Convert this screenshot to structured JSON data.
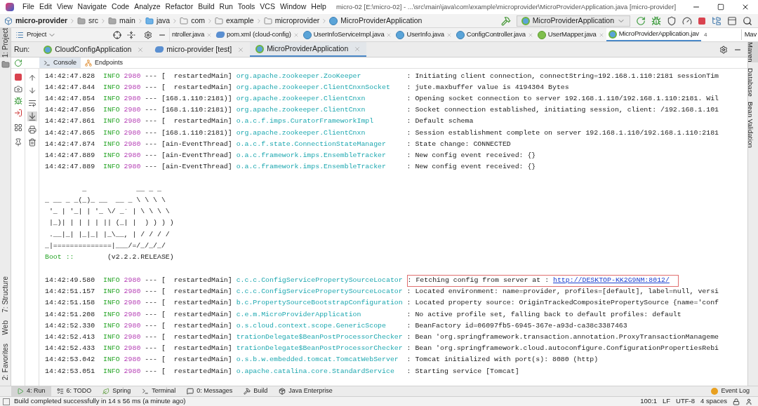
{
  "title_bar": {
    "menu": [
      "File",
      "Edit",
      "View",
      "Navigate",
      "Code",
      "Analyze",
      "Refactor",
      "Build",
      "Run",
      "Tools",
      "VCS",
      "Window",
      "Help"
    ],
    "title": "micro-02 [E:\\micro-02] - ...\\src\\main\\java\\com\\example\\microprovider\\MicroProviderApplication.java [micro-provider]"
  },
  "breadcrumb": [
    {
      "label": "micro-provider",
      "kind": "module"
    },
    {
      "label": "src",
      "kind": "folder"
    },
    {
      "label": "main",
      "kind": "folder"
    },
    {
      "label": "java",
      "kind": "source"
    },
    {
      "label": "com",
      "kind": "package"
    },
    {
      "label": "example",
      "kind": "package"
    },
    {
      "label": "microprovider",
      "kind": "package"
    },
    {
      "label": "MicroProviderApplication",
      "kind": "class"
    }
  ],
  "run_configuration": {
    "label": "MicroProviderApplication"
  },
  "project_panel": {
    "label": "Project"
  },
  "editor_tabs": [
    {
      "label": "ntroller.java",
      "kind": "none",
      "selected": false
    },
    {
      "label": "pom.xml (cloud-config)",
      "kind": "maven",
      "selected": false
    },
    {
      "label": "UserInfoServiceImpl.java",
      "kind": "class",
      "selected": false
    },
    {
      "label": "UserInfo.java",
      "kind": "class",
      "selected": false
    },
    {
      "label": "ConfigController.java",
      "kind": "class",
      "selected": false
    },
    {
      "label": "UserMapper.java",
      "kind": "interface",
      "selected": false
    },
    {
      "label": "MicroProviderApplication.jav",
      "kind": "spring",
      "selected": true
    }
  ],
  "tab_overflow": {
    "count": "4"
  },
  "cut_tab": "Mav",
  "run_panel": {
    "label": "Run:",
    "tabs": [
      {
        "label": "CloudConfigApplication",
        "kind": "spring",
        "selected": false
      },
      {
        "label": "micro-provider [test]",
        "kind": "maven",
        "selected": false
      },
      {
        "label": "MicroProviderApplication",
        "kind": "spring",
        "selected": true
      }
    ],
    "console_tabs": [
      {
        "label": "Console",
        "selected": true
      },
      {
        "label": "Endpoints",
        "selected": false
      }
    ]
  },
  "log": {
    "entries": [
      {
        "time": "14:42:47.828",
        "level": "INFO",
        "pid": "2980",
        "separator": "---",
        "thread": "[  restartedMain]",
        "logger": "org.apache.zookeeper.ZooKeeper",
        "message": ": Initiating client connection, connectString=192.168.1.110:2181 sessionTim"
      },
      {
        "time": "14:42:47.844",
        "level": "INFO",
        "pid": "2980",
        "separator": "---",
        "thread": "[  restartedMain]",
        "logger": "org.apache.zookeeper.ClientCnxnSocket",
        "message": ": jute.maxbuffer value is 4194304 Bytes"
      },
      {
        "time": "14:42:47.854",
        "level": "INFO",
        "pid": "2980",
        "separator": "---",
        "thread": "[168.1.110:2181)]",
        "logger": "org.apache.zookeeper.ClientCnxn",
        "message": ": Opening socket connection to server 192.168.1.110/192.168.1.110:2181. Wil"
      },
      {
        "time": "14:42:47.856",
        "level": "INFO",
        "pid": "2980",
        "separator": "---",
        "thread": "[168.1.110:2181)]",
        "logger": "org.apache.zookeeper.ClientCnxn",
        "message": ": Socket connection established, initiating session, client: /192.168.1.101"
      },
      {
        "time": "14:42:47.861",
        "level": "INFO",
        "pid": "2980",
        "separator": "---",
        "thread": "[  restartedMain]",
        "logger": "o.a.c.f.imps.CuratorFrameworkImpl",
        "message": ": Default schema"
      },
      {
        "time": "14:42:47.865",
        "level": "INFO",
        "pid": "2980",
        "separator": "---",
        "thread": "[168.1.110:2181)]",
        "logger": "org.apache.zookeeper.ClientCnxn",
        "message": ": Session establishment complete on server 192.168.1.110/192.168.1.110:2181"
      },
      {
        "time": "14:42:47.874",
        "level": "INFO",
        "pid": "2980",
        "separator": "---",
        "thread": "[ain-EventThread]",
        "logger": "o.a.c.f.state.ConnectionStateManager",
        "message": ": State change: CONNECTED"
      },
      {
        "time": "14:42:47.889",
        "level": "INFO",
        "pid": "2980",
        "separator": "---",
        "thread": "[ain-EventThread]",
        "logger": "o.a.c.framework.imps.EnsembleTracker",
        "message": ": New config event received: {}"
      },
      {
        "time": "14:42:47.889",
        "level": "INFO",
        "pid": "2980",
        "separator": "---",
        "thread": "[ain-EventThread]",
        "logger": "o.a.c.framework.imps.EnsembleTracker",
        "message": ": New config event received: {}"
      }
    ],
    "banner": {
      "lines": [
        "         _            __ _ _",
        "_ __ _ _(_)_ __  __ _ \\ \\ \\ \\",
        " '_ | '_| | '_ \\/ _` | \\ \\ \\ \\",
        " |_)| | | | | || (_| |  ) ) ) )",
        " .__|_| |_|_| |_\\__, | / / / /",
        "_|==============|___/=/_/_/_/"
      ],
      "boot_label": "Boot ::",
      "version": "(v2.2.2.RELEASE)"
    },
    "later_entries": [
      {
        "time": "14:42:49.580",
        "level": "INFO",
        "pid": "2980",
        "separator": "---",
        "thread": "[  restartedMain]",
        "logger": "c.c.c.ConfigServicePropertySourceLocator",
        "message": ": Fetching config from server at : ",
        "link": "http://DESKTOP-KK2G9NM:8012/",
        "highlighted": true
      },
      {
        "time": "14:42:51.157",
        "level": "INFO",
        "pid": "2980",
        "separator": "---",
        "thread": "[  restartedMain]",
        "logger": "c.c.c.ConfigServicePropertySourceLocator",
        "message": ": Located environment: name=provider, profiles=[default], label=null, versi",
        "highlighted": false
      },
      {
        "time": "14:42:51.158",
        "level": "INFO",
        "pid": "2980",
        "separator": "---",
        "thread": "[  restartedMain]",
        "logger": "b.c.PropertySourceBootstrapConfiguration",
        "message": ": Located property source: OriginTrackedCompositePropertySource {name='conf",
        "highlighted": false
      },
      {
        "time": "14:42:51.208",
        "level": "INFO",
        "pid": "2980",
        "separator": "---",
        "thread": "[  restartedMain]",
        "logger": "c.e.m.MicroProviderApplication",
        "message": ": No active profile set, falling back to default profiles: default",
        "highlighted": false
      },
      {
        "time": "14:42:52.330",
        "level": "INFO",
        "pid": "2980",
        "separator": "---",
        "thread": "[  restartedMain]",
        "logger": "o.s.cloud.context.scope.GenericScope",
        "message": ": BeanFactory id=06097fb5-6945-367e-a93d-ca38c3387463",
        "highlighted": false
      },
      {
        "time": "14:42:52.413",
        "level": "INFO",
        "pid": "2980",
        "separator": "---",
        "thread": "[  restartedMain]",
        "logger": "trationDelegate$BeanPostProcessorChecker",
        "message": ": Bean 'org.springframework.transaction.annotation.ProxyTransactionManageme",
        "highlighted": false
      },
      {
        "time": "14:42:52.433",
        "level": "INFO",
        "pid": "2980",
        "separator": "---",
        "thread": "[  restartedMain]",
        "logger": "trationDelegate$BeanPostProcessorChecker",
        "message": ": Bean 'org.springframework.cloud.autoconfigure.ConfigurationPropertiesRebi",
        "highlighted": false
      },
      {
        "time": "14:42:53.042",
        "level": "INFO",
        "pid": "2980",
        "separator": "---",
        "thread": "[  restartedMain]",
        "logger": "o.s.b.w.embedded.tomcat.TomcatWebServer",
        "message": ": Tomcat initialized with port(s): 8080 (http)",
        "highlighted": false
      },
      {
        "time": "14:42:53.051",
        "level": "INFO",
        "pid": "2980",
        "separator": "---",
        "thread": "[  restartedMain]",
        "logger": "o.apache.catalina.core.StandardService",
        "message": ": Starting service [Tomcat]",
        "highlighted": false
      }
    ]
  },
  "left_tool_tabs": {
    "top": [
      "1: Project"
    ],
    "bottom": [
      "7: Structure",
      "Web",
      "2: Favorites"
    ]
  },
  "right_tool_tabs": [
    {
      "label": "Maven",
      "selected": true
    },
    {
      "label": "Database",
      "selected": false
    },
    {
      "label": "Bean Validation",
      "selected": false
    }
  ],
  "bottom_tool_tabs": [
    {
      "label": "4: Run",
      "selected": true
    },
    {
      "label": "6: TODO",
      "selected": false
    },
    {
      "label": "Spring",
      "selected": false
    },
    {
      "label": "Terminal",
      "selected": false
    },
    {
      "label": "0: Messages",
      "selected": false
    },
    {
      "label": "Build",
      "selected": false
    },
    {
      "label": "Java Enterprise",
      "selected": false
    }
  ],
  "event_log": "Event Log",
  "status_bar": {
    "message": "Build completed successfully in 14 s 56 ms (a minute ago)",
    "position": "100:1",
    "line_separator": "LF",
    "encoding": "UTF-8",
    "indent": "4 spaces"
  }
}
